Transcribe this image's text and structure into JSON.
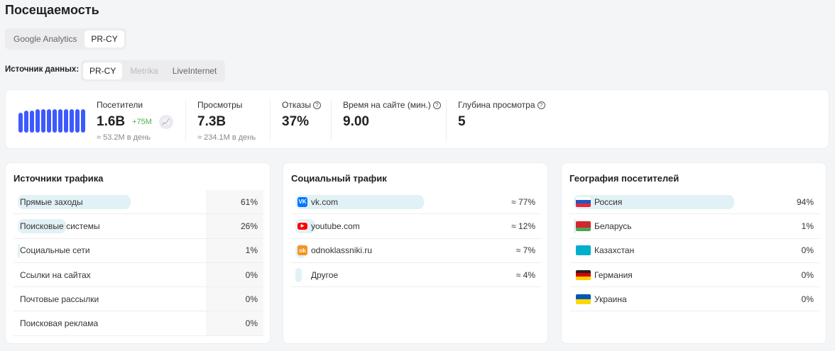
{
  "title": "Посещаемость",
  "tabs": [
    {
      "label": "Google Analytics",
      "active": false
    },
    {
      "label": "PR-CY",
      "active": true
    }
  ],
  "source": {
    "label": "Источник данных:",
    "options": [
      {
        "label": "PR-CY",
        "state": "active"
      },
      {
        "label": "Metrika",
        "state": "disabled"
      },
      {
        "label": "LiveInternet",
        "state": "normal"
      }
    ]
  },
  "sparkline": [
    0.8,
    0.88,
    0.9,
    0.95,
    0.93,
    0.95,
    0.95,
    0.93,
    0.93,
    0.93,
    0.93,
    0.93
  ],
  "accent": "#3d5afe",
  "stats": {
    "visitors": {
      "label": "Посетители",
      "value": "1.6B",
      "growth": "+75M",
      "sub": "≈ 53.2M в день"
    },
    "views": {
      "label": "Просмотры",
      "value": "7.3B",
      "sub": "≈ 234.1M в день"
    },
    "bounce": {
      "label": "Отказы",
      "value": "37%"
    },
    "time": {
      "label": "Время на сайте (мин.)",
      "value": "9.00"
    },
    "depth": {
      "label": "Глубина просмотра",
      "value": "5"
    }
  },
  "traffic": {
    "title": "Источники трафика",
    "rows": [
      {
        "name": "Прямые заходы",
        "pct": "61%",
        "share": 61
      },
      {
        "name": "Поисковые системы",
        "pct": "26%",
        "share": 26
      },
      {
        "name": "Социальные сети",
        "pct": "1%",
        "share": 1
      },
      {
        "name": "Ссылки на сайтах",
        "pct": "0%",
        "share": 0
      },
      {
        "name": "Почтовые рассылки",
        "pct": "0%",
        "share": 0
      },
      {
        "name": "Поисковая реклама",
        "pct": "0%",
        "share": 0
      }
    ]
  },
  "social": {
    "title": "Социальный трафик",
    "rows": [
      {
        "name": "vk.com",
        "pct": "≈ 77%",
        "share": 77,
        "icon": "vk-icon"
      },
      {
        "name": "youtube.com",
        "pct": "≈ 12%",
        "share": 12,
        "icon": "youtube-icon"
      },
      {
        "name": "odnoklassniki.ru",
        "pct": "≈ 7%",
        "share": 7,
        "icon": "odnoklassniki-icon"
      },
      {
        "name": "Другое",
        "pct": "≈ 4%",
        "share": 4,
        "icon": "none"
      }
    ]
  },
  "geo": {
    "title": "География посетителей",
    "rows": [
      {
        "name": "Россия",
        "pct": "94%",
        "share": 94
      },
      {
        "name": "Беларусь",
        "pct": "1%",
        "share": 1
      },
      {
        "name": "Казахстан",
        "pct": "0%",
        "share": 0
      },
      {
        "name": "Германия",
        "pct": "0%",
        "share": 0
      },
      {
        "name": "Украина",
        "pct": "0%",
        "share": 0
      }
    ]
  }
}
